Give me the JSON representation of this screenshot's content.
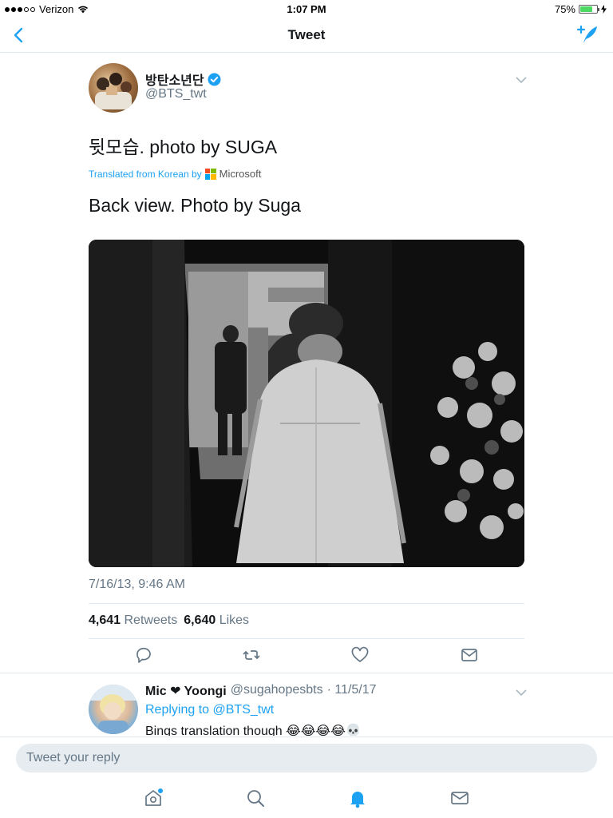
{
  "status_bar": {
    "carrier": "Verizon",
    "time": "1:07 PM",
    "battery": "75%",
    "battery_level": 0.75
  },
  "nav": {
    "title": "Tweet"
  },
  "tweet": {
    "display_name": "방탄소년단",
    "handle": "@BTS_twt",
    "text": "뒷모습. photo by SUGA",
    "translated_from": "Translated from Korean by",
    "translator": "Microsoft",
    "translation": "Back view. Photo by Suga",
    "timestamp": "7/16/13, 9:46 AM",
    "retweets_count": "4,641",
    "retweets_label": "Retweets",
    "likes_count": "6,640",
    "likes_label": "Likes"
  },
  "reply": {
    "display_name": "Mic ❤ Yoongi",
    "handle": "@sugahopesbts",
    "date": "· 11/5/17",
    "replying_to_label": "Replying to",
    "replying_to_handle": "@BTS_twt",
    "text": "Bings translation though 😂😂😂😂💀"
  },
  "compose": {
    "placeholder": "Tweet your reply"
  },
  "colors": {
    "accent": "#1da1f2",
    "muted": "#657786",
    "separator": "#e1e8ed",
    "battery": "#4cd964"
  },
  "icons": {
    "nav": [
      "back-chevron-icon",
      "compose-tweet-icon"
    ],
    "actions": [
      "reply-icon",
      "retweet-icon",
      "like-icon",
      "direct-message-icon"
    ],
    "tabs": [
      "home-icon",
      "search-icon",
      "notifications-icon",
      "messages-icon"
    ]
  }
}
